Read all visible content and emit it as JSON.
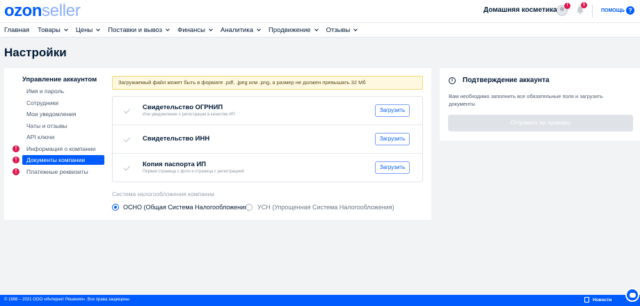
{
  "header": {
    "logo_brand": "ozon",
    "logo_suffix": "seller",
    "store_name": "Домашняя косметика",
    "avatar_badge": "!",
    "bell_badge": "1",
    "help_label": "ПОМОЩЬ",
    "help_icon_glyph": "?"
  },
  "nav": {
    "items": [
      {
        "label": "Главная",
        "dropdown": false
      },
      {
        "label": "Товары",
        "dropdown": true
      },
      {
        "label": "Цены",
        "dropdown": true
      },
      {
        "label": "Поставки и вывоз",
        "dropdown": true
      },
      {
        "label": "Финансы",
        "dropdown": true
      },
      {
        "label": "Аналитика",
        "dropdown": true
      },
      {
        "label": "Продвижение",
        "dropdown": true
      },
      {
        "label": "Отзывы",
        "dropdown": true
      }
    ]
  },
  "page": {
    "title": "Настройки"
  },
  "sidebar": {
    "title": "Управление аккаунтом",
    "items": [
      {
        "label": "Имя и пароль",
        "alert": false,
        "active": false
      },
      {
        "label": "Сотрудники",
        "alert": false,
        "active": false
      },
      {
        "label": "Мои уведомления",
        "alert": false,
        "active": false
      },
      {
        "label": "Чаты и отзывы",
        "alert": false,
        "active": false
      },
      {
        "label": "API ключи",
        "alert": false,
        "active": false
      },
      {
        "label": "Информация о компании",
        "alert": true,
        "active": false
      },
      {
        "label": "Документы компании",
        "alert": true,
        "active": true
      },
      {
        "label": "Платежные реквизиты",
        "alert": true,
        "active": false
      }
    ],
    "alert_glyph": "!"
  },
  "documents": {
    "warning": "Загружаемый файл может быть в формате .pdf, .jpeg или .png, а размер не должен превышать 32 Мб",
    "rows": [
      {
        "title": "Свидетельство ОГРНИП",
        "subtitle": "Или уведомление о регистрации в качестве ИП",
        "button": "Загрузить"
      },
      {
        "title": "Свидетельство ИНН",
        "subtitle": "",
        "button": "Загрузить"
      },
      {
        "title": "Копия паспорта ИП",
        "subtitle": "Первая страница с фото и страница с регистрацией",
        "button": "Загрузить"
      }
    ]
  },
  "tax": {
    "label": "Система налогообложения компании",
    "options": [
      {
        "label": "ОСНО (Общая Система Налогообложения)",
        "selected": true
      },
      {
        "label": "УСН (Упрощенная Система Налогообложения)",
        "selected": false
      }
    ]
  },
  "verification": {
    "info_glyph": "i",
    "title": "Подтверждение аккаунта",
    "text": "Вам необходимо заполнить все обязательные поля и загрузить документы",
    "button": "Отправить на проверку"
  },
  "footer": {
    "copyright": "© 1998 – 2021 ООО «Интернет Решения». Все права защищены",
    "news_label": "Новости"
  },
  "colors": {
    "brand": "#005bff",
    "alert": "#e0144c",
    "warning_bg": "#fff8e1"
  }
}
